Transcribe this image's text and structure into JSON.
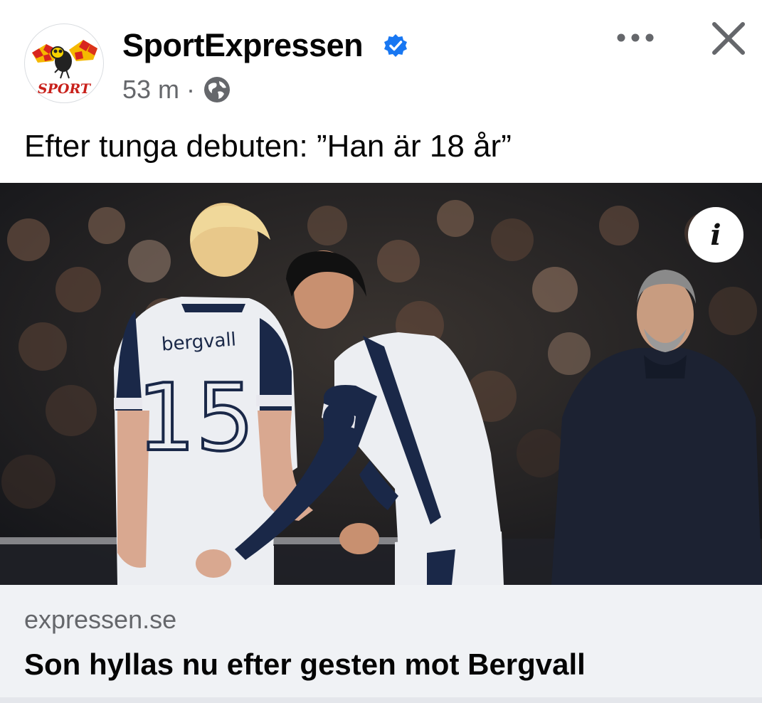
{
  "post": {
    "page_name": "SportExpressen",
    "time": "53 m",
    "separator": "·",
    "text": "Efter tunga debuten: ”Han är 18 år”",
    "logo_text": "SPORT"
  },
  "photo": {
    "jersey_left_name": "bergvall",
    "jersey_left_number": "15",
    "info_label": "i"
  },
  "link": {
    "domain": "expressen.se",
    "title": "Son hyllas nu efter gesten mot Bergvall"
  },
  "icons": {
    "verified": "verified-badge-icon",
    "privacy": "globe-icon",
    "more": "more-dots-icon",
    "close": "close-icon",
    "info": "info-icon"
  },
  "colors": {
    "verified": "#1877f2",
    "secondary_text": "#65676b",
    "link_bar": "#f0f2f5"
  }
}
